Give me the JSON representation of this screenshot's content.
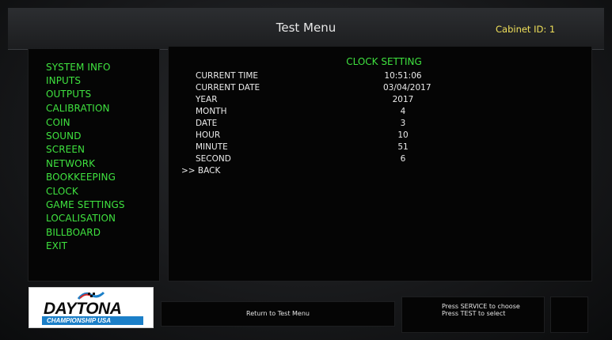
{
  "header": {
    "title": "Test Menu",
    "cabinet_label": "Cabinet ID: 1"
  },
  "sidebar": {
    "items": [
      {
        "label": "SYSTEM INFO"
      },
      {
        "label": "INPUTS"
      },
      {
        "label": "OUTPUTS"
      },
      {
        "label": "CALIBRATION"
      },
      {
        "label": "COIN"
      },
      {
        "label": "SOUND"
      },
      {
        "label": "SCREEN"
      },
      {
        "label": "NETWORK"
      },
      {
        "label": "BOOKKEEPING"
      },
      {
        "label": "CLOCK"
      },
      {
        "label": "GAME SETTINGS"
      },
      {
        "label": "LOCALISATION"
      },
      {
        "label": "BILLBOARD"
      },
      {
        "label": "EXIT"
      }
    ]
  },
  "main": {
    "section_title": "CLOCK SETTING",
    "rows": [
      {
        "label": "CURRENT TIME",
        "value": "10:51:06"
      },
      {
        "label": "CURRENT DATE",
        "value": "03/04/2017"
      },
      {
        "label": "YEAR",
        "value": "2017"
      },
      {
        "label": "MONTH",
        "value": "4"
      },
      {
        "label": "DATE",
        "value": "3"
      },
      {
        "label": "HOUR",
        "value": "10"
      },
      {
        "label": "MINUTE",
        "value": "51"
      },
      {
        "label": "SECOND",
        "value": "6"
      }
    ],
    "back_label": ">> BACK"
  },
  "footer": {
    "logo_text": "DAYTONA",
    "logo_subtext": "CHAMPIONSHIP USA",
    "return_label": "Return to Test Menu",
    "hint_line1": "Press SERVICE to choose",
    "hint_line2": "Press TEST to select"
  },
  "colors": {
    "menu_green": "#3fe23f",
    "cabinet_yellow": "#f0e05a",
    "logo_blue": "#1b7fc8"
  }
}
